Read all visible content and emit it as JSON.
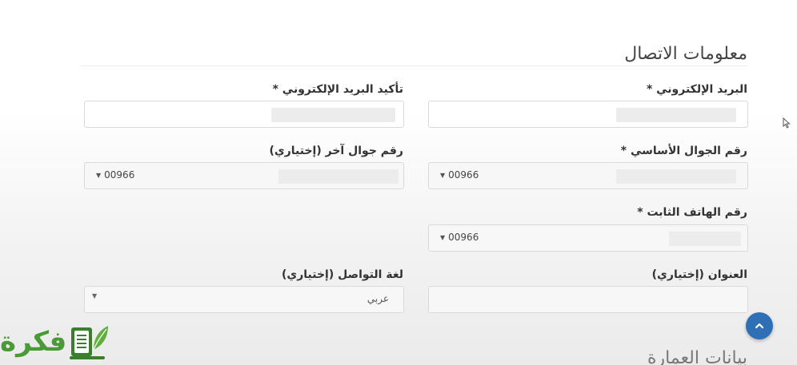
{
  "section": {
    "title": "معلومات الاتصال",
    "next_title": "بيانات العمارة"
  },
  "fields": {
    "email": {
      "label": "البريد الإلكتروني *"
    },
    "email_confirm": {
      "label": "تأكيد البريد الإلكتروني *"
    },
    "mobile_main": {
      "label": "رقم الجوال الأساسي *",
      "prefix": "00966"
    },
    "mobile_other": {
      "label": "رقم جوال آخر (إختياري)",
      "prefix": "00966"
    },
    "landline": {
      "label": "رقم الهاتف الثابت *",
      "prefix": "00966"
    },
    "address": {
      "label": "العنوان (إختياري)"
    },
    "language": {
      "label": "لغة التواصل (إختياري)",
      "value": "عربي"
    }
  },
  "logo": {
    "text": "فكرة",
    "color": "#4a9a38"
  },
  "colors": {
    "accent": "#2f6fb5"
  },
  "icons": {
    "scroll_top": "chevron-up-icon",
    "cursor": "mouse-pointer-icon",
    "caret": "caret-down-icon"
  }
}
